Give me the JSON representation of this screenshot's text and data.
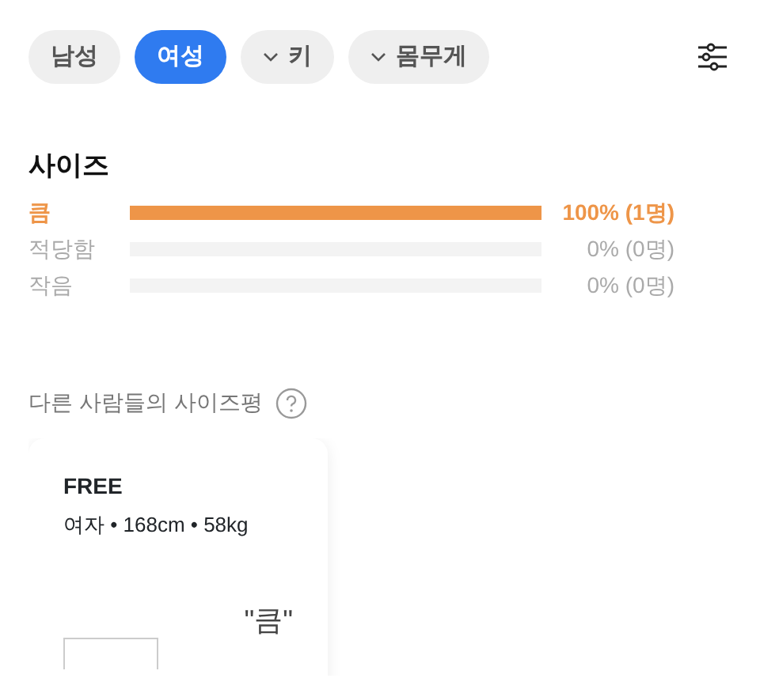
{
  "filters": [
    {
      "label": "남성",
      "kind": "toggle",
      "selected": false
    },
    {
      "label": "여성",
      "kind": "toggle",
      "selected": true
    },
    {
      "label": "키",
      "kind": "dropdown",
      "selected": false
    },
    {
      "label": "몸무게",
      "kind": "dropdown",
      "selected": false
    }
  ],
  "size_section": {
    "title": "사이즈",
    "rows": [
      {
        "label": "큼",
        "level": 1,
        "reading": "100% (1명)",
        "selected": true
      },
      {
        "label": "적당함",
        "reading": "0% (0명)",
        "selected": false
      },
      {
        "label": "작음",
        "reading": "0% (0명)",
        "selected": false
      }
    ]
  },
  "reviews": {
    "title": "다른 사람들의 사이즈평",
    "cards": [
      {
        "size": "FREE",
        "profile": "여자 • 168cm • 58kg",
        "verdict": "\"큼\""
      }
    ]
  }
}
